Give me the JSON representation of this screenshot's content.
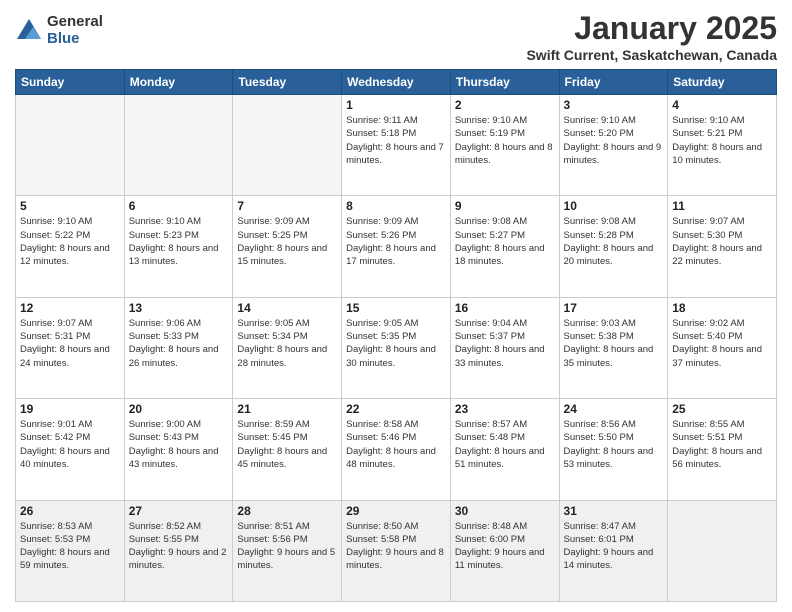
{
  "logo": {
    "general": "General",
    "blue": "Blue"
  },
  "title": "January 2025",
  "location": "Swift Current, Saskatchewan, Canada",
  "days_header": [
    "Sunday",
    "Monday",
    "Tuesday",
    "Wednesday",
    "Thursday",
    "Friday",
    "Saturday"
  ],
  "weeks": [
    [
      {
        "num": "",
        "info": ""
      },
      {
        "num": "",
        "info": ""
      },
      {
        "num": "",
        "info": ""
      },
      {
        "num": "1",
        "info": "Sunrise: 9:11 AM\nSunset: 5:18 PM\nDaylight: 8 hours\nand 7 minutes."
      },
      {
        "num": "2",
        "info": "Sunrise: 9:10 AM\nSunset: 5:19 PM\nDaylight: 8 hours\nand 8 minutes."
      },
      {
        "num": "3",
        "info": "Sunrise: 9:10 AM\nSunset: 5:20 PM\nDaylight: 8 hours\nand 9 minutes."
      },
      {
        "num": "4",
        "info": "Sunrise: 9:10 AM\nSunset: 5:21 PM\nDaylight: 8 hours\nand 10 minutes."
      }
    ],
    [
      {
        "num": "5",
        "info": "Sunrise: 9:10 AM\nSunset: 5:22 PM\nDaylight: 8 hours\nand 12 minutes."
      },
      {
        "num": "6",
        "info": "Sunrise: 9:10 AM\nSunset: 5:23 PM\nDaylight: 8 hours\nand 13 minutes."
      },
      {
        "num": "7",
        "info": "Sunrise: 9:09 AM\nSunset: 5:25 PM\nDaylight: 8 hours\nand 15 minutes."
      },
      {
        "num": "8",
        "info": "Sunrise: 9:09 AM\nSunset: 5:26 PM\nDaylight: 8 hours\nand 17 minutes."
      },
      {
        "num": "9",
        "info": "Sunrise: 9:08 AM\nSunset: 5:27 PM\nDaylight: 8 hours\nand 18 minutes."
      },
      {
        "num": "10",
        "info": "Sunrise: 9:08 AM\nSunset: 5:28 PM\nDaylight: 8 hours\nand 20 minutes."
      },
      {
        "num": "11",
        "info": "Sunrise: 9:07 AM\nSunset: 5:30 PM\nDaylight: 8 hours\nand 22 minutes."
      }
    ],
    [
      {
        "num": "12",
        "info": "Sunrise: 9:07 AM\nSunset: 5:31 PM\nDaylight: 8 hours\nand 24 minutes."
      },
      {
        "num": "13",
        "info": "Sunrise: 9:06 AM\nSunset: 5:33 PM\nDaylight: 8 hours\nand 26 minutes."
      },
      {
        "num": "14",
        "info": "Sunrise: 9:05 AM\nSunset: 5:34 PM\nDaylight: 8 hours\nand 28 minutes."
      },
      {
        "num": "15",
        "info": "Sunrise: 9:05 AM\nSunset: 5:35 PM\nDaylight: 8 hours\nand 30 minutes."
      },
      {
        "num": "16",
        "info": "Sunrise: 9:04 AM\nSunset: 5:37 PM\nDaylight: 8 hours\nand 33 minutes."
      },
      {
        "num": "17",
        "info": "Sunrise: 9:03 AM\nSunset: 5:38 PM\nDaylight: 8 hours\nand 35 minutes."
      },
      {
        "num": "18",
        "info": "Sunrise: 9:02 AM\nSunset: 5:40 PM\nDaylight: 8 hours\nand 37 minutes."
      }
    ],
    [
      {
        "num": "19",
        "info": "Sunrise: 9:01 AM\nSunset: 5:42 PM\nDaylight: 8 hours\nand 40 minutes."
      },
      {
        "num": "20",
        "info": "Sunrise: 9:00 AM\nSunset: 5:43 PM\nDaylight: 8 hours\nand 43 minutes."
      },
      {
        "num": "21",
        "info": "Sunrise: 8:59 AM\nSunset: 5:45 PM\nDaylight: 8 hours\nand 45 minutes."
      },
      {
        "num": "22",
        "info": "Sunrise: 8:58 AM\nSunset: 5:46 PM\nDaylight: 8 hours\nand 48 minutes."
      },
      {
        "num": "23",
        "info": "Sunrise: 8:57 AM\nSunset: 5:48 PM\nDaylight: 8 hours\nand 51 minutes."
      },
      {
        "num": "24",
        "info": "Sunrise: 8:56 AM\nSunset: 5:50 PM\nDaylight: 8 hours\nand 53 minutes."
      },
      {
        "num": "25",
        "info": "Sunrise: 8:55 AM\nSunset: 5:51 PM\nDaylight: 8 hours\nand 56 minutes."
      }
    ],
    [
      {
        "num": "26",
        "info": "Sunrise: 8:53 AM\nSunset: 5:53 PM\nDaylight: 8 hours\nand 59 minutes."
      },
      {
        "num": "27",
        "info": "Sunrise: 8:52 AM\nSunset: 5:55 PM\nDaylight: 9 hours\nand 2 minutes."
      },
      {
        "num": "28",
        "info": "Sunrise: 8:51 AM\nSunset: 5:56 PM\nDaylight: 9 hours\nand 5 minutes."
      },
      {
        "num": "29",
        "info": "Sunrise: 8:50 AM\nSunset: 5:58 PM\nDaylight: 9 hours\nand 8 minutes."
      },
      {
        "num": "30",
        "info": "Sunrise: 8:48 AM\nSunset: 6:00 PM\nDaylight: 9 hours\nand 11 minutes."
      },
      {
        "num": "31",
        "info": "Sunrise: 8:47 AM\nSunset: 6:01 PM\nDaylight: 9 hours\nand 14 minutes."
      },
      {
        "num": "",
        "info": ""
      }
    ]
  ]
}
